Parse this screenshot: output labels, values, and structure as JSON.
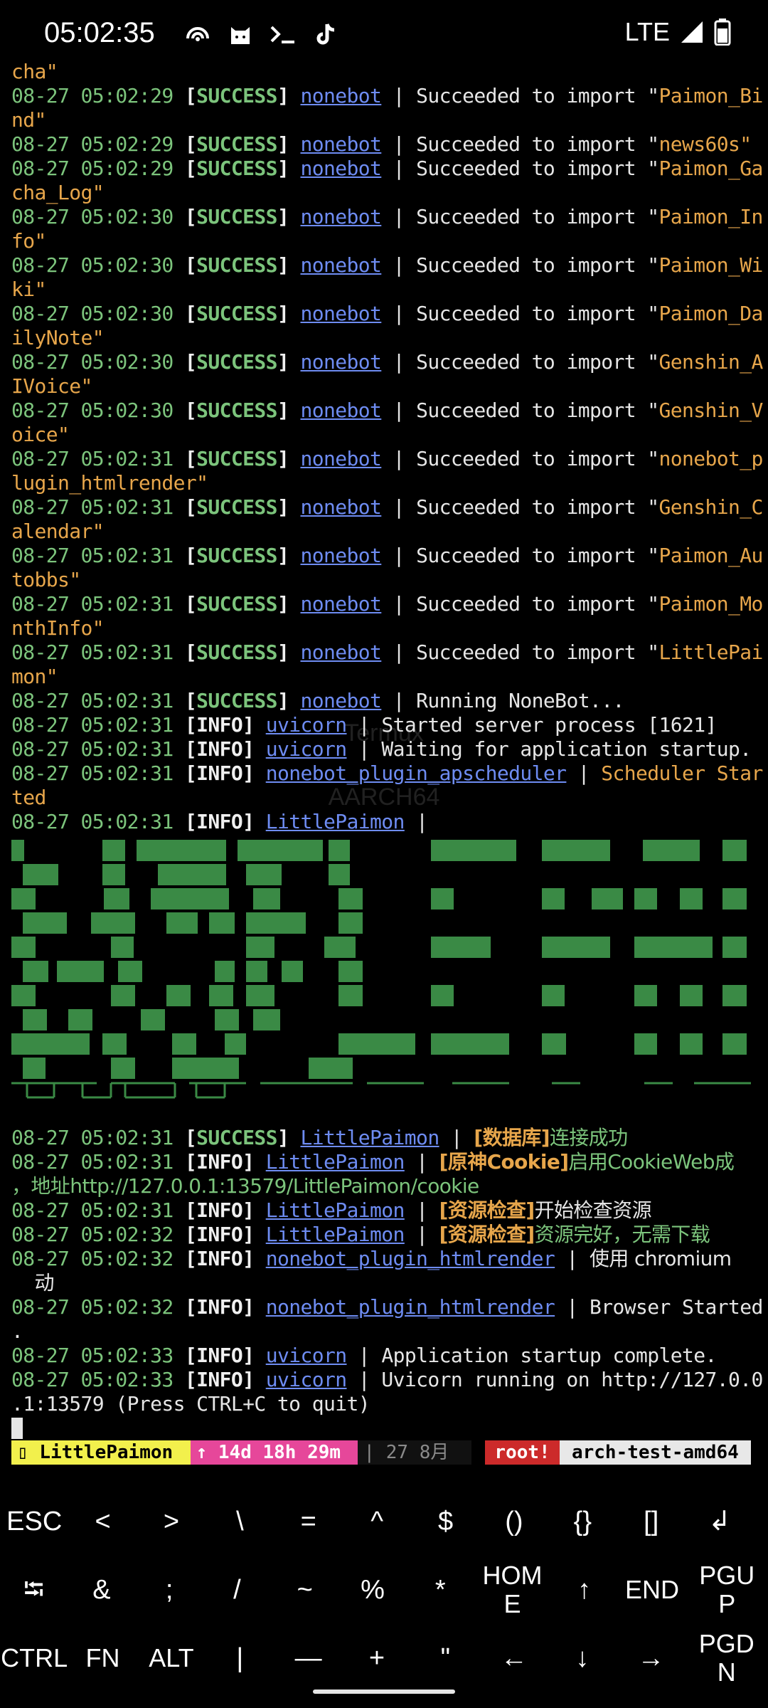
{
  "status_bar": {
    "time": "05:02:35",
    "icons": [
      "hotspot-icon",
      "cat-icon",
      "terminal-prompt-icon",
      "tiktok-icon"
    ],
    "network": "LTE"
  },
  "watermark": [
    "Termux",
    "AARCH64"
  ],
  "log": {
    "cont0": "cha\"",
    "r1": {
      "ts": "08-27 05:02:29",
      "lvl": "SUCCESS",
      "src": "nonebot",
      "text": "Succeeded to import \"",
      "mod": "Paimon_Bi",
      "cont": "nd\""
    },
    "r2": {
      "ts": "08-27 05:02:29",
      "lvl": "SUCCESS",
      "src": "nonebot",
      "text": "Succeeded to import \"",
      "mod": "news60s\""
    },
    "r3": {
      "ts": "08-27 05:02:29",
      "lvl": "SUCCESS",
      "src": "nonebot",
      "text": "Succeeded to import \"",
      "mod": "Paimon_Ga",
      "cont": "cha_Log\""
    },
    "r4": {
      "ts": "08-27 05:02:30",
      "lvl": "SUCCESS",
      "src": "nonebot",
      "text": "Succeeded to import \"",
      "mod": "Paimon_In",
      "cont": "fo\""
    },
    "r5": {
      "ts": "08-27 05:02:30",
      "lvl": "SUCCESS",
      "src": "nonebot",
      "text": "Succeeded to import \"",
      "mod": "Paimon_Wi",
      "cont": "ki\""
    },
    "r6": {
      "ts": "08-27 05:02:30",
      "lvl": "SUCCESS",
      "src": "nonebot",
      "text": "Succeeded to import \"",
      "mod": "Paimon_Da",
      "cont": "ilyNote\""
    },
    "r7": {
      "ts": "08-27 05:02:30",
      "lvl": "SUCCESS",
      "src": "nonebot",
      "text": "Succeeded to import \"",
      "mod": "Genshin_A",
      "cont": "IVoice\""
    },
    "r8": {
      "ts": "08-27 05:02:30",
      "lvl": "SUCCESS",
      "src": "nonebot",
      "text": "Succeeded to import \"",
      "mod": "Genshin_V",
      "cont": "oice\""
    },
    "r9": {
      "ts": "08-27 05:02:31",
      "lvl": "SUCCESS",
      "src": "nonebot",
      "text": "Succeeded to import \"",
      "mod": "nonebot_p",
      "cont": "lugin_htmlrender\""
    },
    "r10": {
      "ts": "08-27 05:02:31",
      "lvl": "SUCCESS",
      "src": "nonebot",
      "text": "Succeeded to import \"",
      "mod": "Genshin_C",
      "cont": "alendar\""
    },
    "r11": {
      "ts": "08-27 05:02:31",
      "lvl": "SUCCESS",
      "src": "nonebot",
      "text": "Succeeded to import \"",
      "mod": "Paimon_Au",
      "cont": "tobbs\""
    },
    "r12": {
      "ts": "08-27 05:02:31",
      "lvl": "SUCCESS",
      "src": "nonebot",
      "text": "Succeeded to import \"",
      "mod": "Paimon_Mo",
      "cont": "nthInfo\""
    },
    "r13": {
      "ts": "08-27 05:02:31",
      "lvl": "SUCCESS",
      "src": "nonebot",
      "text": "Succeeded to import \"",
      "mod": "LittlePai",
      "cont": "mon\""
    },
    "r14": {
      "ts": "08-27 05:02:31",
      "lvl": "SUCCESS",
      "src": "nonebot",
      "text": "Running NoneBot..."
    },
    "r15": {
      "ts": "08-27 05:02:31",
      "lvl": "INFO",
      "src": "uvicorn",
      "text": "Started server process [1621]"
    },
    "r16": {
      "ts": "08-27 05:02:31",
      "lvl": "INFO",
      "src": "uvicorn",
      "text": "Waiting for application startup."
    },
    "r17": {
      "ts": "08-27 05:02:31",
      "lvl": "INFO",
      "src": "nonebot_plugin_apscheduler",
      "text": "Scheduler Star",
      "cont": "ted"
    },
    "r18": {
      "ts": "08-27 05:02:31",
      "lvl": "INFO",
      "src": "LittlePaimon",
      "text": ""
    },
    "r19": {
      "ts": "08-27 05:02:31",
      "lvl": "SUCCESS",
      "src": "LittlePaimon",
      "tag": "[数据库]",
      "text": "连接成功"
    },
    "r20": {
      "ts": "08-27 05:02:31",
      "lvl": "INFO",
      "src": "LittlePaimon",
      "tag": "[原神Cookie]",
      "text": "启用CookieWeb成",
      "cont": "，地址http://127.0.0.1:13579/LittlePaimon/cookie"
    },
    "r21": {
      "ts": "08-27 05:02:31",
      "lvl": "INFO",
      "src": "LittlePaimon",
      "tag": "[资源检查]",
      "text": "开始检查资源"
    },
    "r22": {
      "ts": "08-27 05:02:32",
      "lvl": "INFO",
      "src": "LittlePaimon",
      "tag": "[资源检查]",
      "text": "资源完好，无需下载"
    },
    "r23": {
      "ts": "08-27 05:02:32",
      "lvl": "INFO",
      "src": "nonebot_plugin_htmlrender",
      "text": "使用 chromium",
      "cont": "动"
    },
    "r24": {
      "ts": "08-27 05:02:32",
      "lvl": "INFO",
      "src": "nonebot_plugin_htmlrender",
      "text": "Browser Started",
      "cont": "."
    },
    "r25": {
      "ts": "08-27 05:02:33",
      "lvl": "INFO",
      "src": "uvicorn",
      "text": "Application startup complete."
    },
    "r26": {
      "ts": "08-27 05:02:33",
      "lvl": "INFO",
      "src": "uvicorn",
      "text": "Uvicorn running on http://127.0.0",
      "cont": ".1:13579 (Press CTRL+C to quit)"
    }
  },
  "tmux": {
    "session": "LittlePaimon",
    "uptime": "↑ 14d 18h 29m",
    "date": "| 27 8月",
    "user": "root!",
    "host": "arch-test-amd64"
  },
  "keys": {
    "row1": [
      "ESC",
      "<",
      ">",
      "\\",
      "=",
      "^",
      "$",
      "()",
      "{}",
      "[]",
      "↲"
    ],
    "row2": [
      "⭾",
      "&",
      ";",
      "/",
      "~",
      "%",
      "*",
      "HOME",
      "↑",
      "END",
      "PGUP"
    ],
    "row3": [
      "CTRL",
      "FN",
      "ALT",
      "|",
      "—",
      "+",
      "\"",
      "←",
      "↓",
      "→",
      "PGDN"
    ]
  }
}
